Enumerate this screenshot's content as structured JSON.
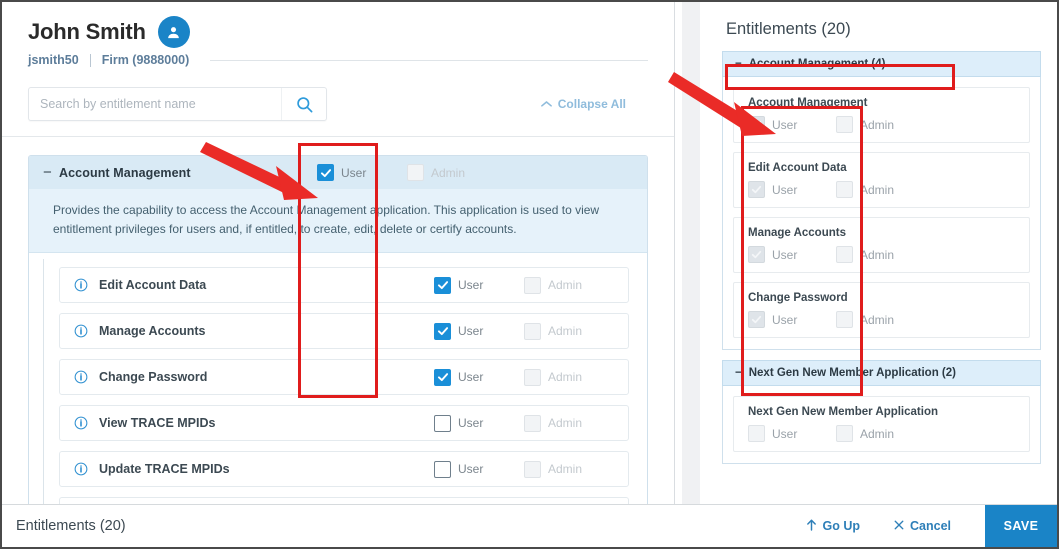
{
  "header": {
    "user_name": "John Smith",
    "avatar_icon": "user-avatar-icon",
    "username": "jsmith50",
    "firm": "Firm (9888000)"
  },
  "search": {
    "placeholder": "Search by entitlement name",
    "value": "",
    "icon": "search-icon",
    "collapse_all_label": "Collapse All",
    "collapse_all_icon": "chevron-up-icon"
  },
  "left_panel": {
    "group": {
      "toggle_sign": "−",
      "title": "Account Management",
      "description": "Provides the capability to access the Account Management application. This application is used to view entitlement privileges for users and, if entitled, to create, edit, delete or certify accounts.",
      "user_label": "User",
      "admin_label": "Admin",
      "user_checked": true,
      "admin_checked": false,
      "admin_disabled": true
    },
    "rows": [
      {
        "info_icon": "info-icon",
        "name": "Edit Account Data",
        "user_label": "User",
        "user_checked": true,
        "user_disabled": false,
        "admin_label": "Admin",
        "admin_checked": false,
        "admin_disabled": true
      },
      {
        "info_icon": "info-icon",
        "name": "Manage Accounts",
        "user_label": "User",
        "user_checked": true,
        "user_disabled": false,
        "admin_label": "Admin",
        "admin_checked": false,
        "admin_disabled": true
      },
      {
        "info_icon": "info-icon",
        "name": "Change Password",
        "user_label": "User",
        "user_checked": true,
        "user_disabled": false,
        "admin_label": "Admin",
        "admin_checked": false,
        "admin_disabled": true
      },
      {
        "info_icon": "info-icon",
        "name": "View TRACE MPIDs",
        "user_label": "User",
        "user_checked": false,
        "user_disabled": false,
        "admin_label": "Admin",
        "admin_checked": false,
        "admin_disabled": true
      },
      {
        "info_icon": "info-icon",
        "name": "Update TRACE MPIDs",
        "user_label": "User",
        "user_checked": false,
        "user_disabled": false,
        "admin_label": "Admin",
        "admin_checked": false,
        "admin_disabled": true
      }
    ]
  },
  "right_panel": {
    "title": "Entitlements (20)",
    "groups": [
      {
        "toggle_sign": "−",
        "title": "Account Management (4)",
        "items": [
          {
            "name": "Account Management",
            "user_label": "User",
            "user_checked": true,
            "admin_label": "Admin",
            "admin_checked": false
          },
          {
            "name": "Edit Account Data",
            "user_label": "User",
            "user_checked": true,
            "admin_label": "Admin",
            "admin_checked": false
          },
          {
            "name": "Manage Accounts",
            "user_label": "User",
            "user_checked": true,
            "admin_label": "Admin",
            "admin_checked": false
          },
          {
            "name": "Change Password",
            "user_label": "User",
            "user_checked": true,
            "admin_label": "Admin",
            "admin_checked": false
          }
        ]
      },
      {
        "toggle_sign": "−",
        "title": "Next Gen New Member Application (2)",
        "items": [
          {
            "name": "Next Gen New Member Application",
            "user_label": "User",
            "user_checked": false,
            "admin_label": "Admin",
            "admin_checked": false
          }
        ]
      }
    ]
  },
  "footer": {
    "entitlements_label": "Entitlements (20)",
    "go_up_label": "Go Up",
    "go_up_icon": "arrow-up-icon",
    "cancel_label": "Cancel",
    "cancel_icon": "close-icon",
    "save_label": "SAVE"
  },
  "colors": {
    "accent_blue": "#1a84c7",
    "checkbox_blue": "#1a8fd8",
    "group_header_bg": "#d9eaf5",
    "annotation_red": "#e01c1c",
    "link_blue": "#2e7fb8"
  },
  "annotations": {
    "rect_left_label": "highlight-user-column",
    "rect_right_group_label": "highlight-account-management-group",
    "rect_right_items_label": "highlight-account-management-items",
    "arrow_left_label": "arrow-to-user-column",
    "arrow_right_label": "arrow-to-summary-items"
  }
}
